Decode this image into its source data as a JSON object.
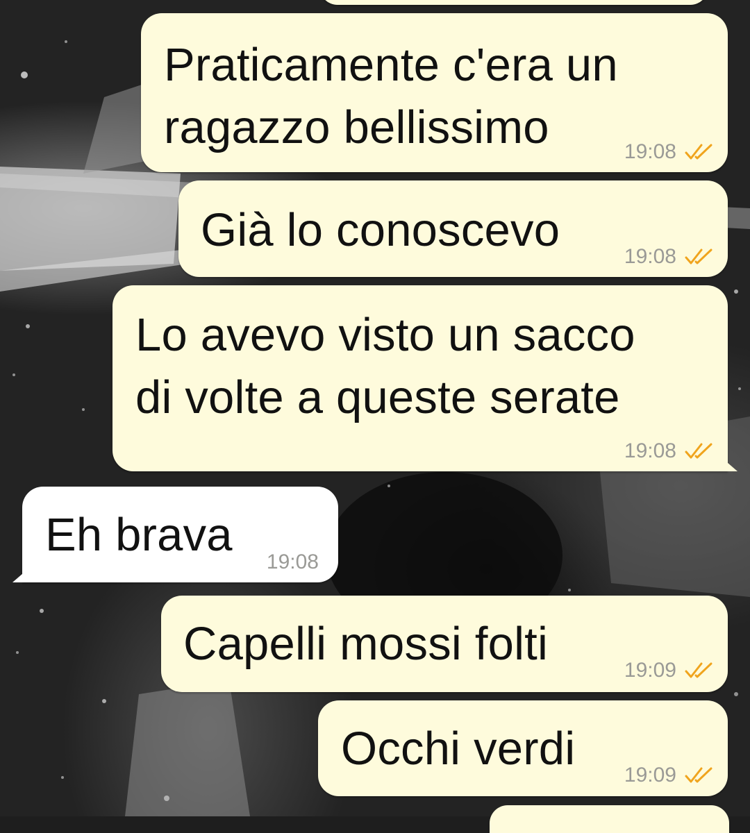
{
  "status_color": "#f0a41d",
  "messages": [
    {
      "direction": "outgoing",
      "text": "Praticamente c'era un\nragazzo bellissimo",
      "time": "19:08",
      "status_icon": "double-check-icon"
    },
    {
      "direction": "outgoing",
      "text": "Già lo conoscevo",
      "time": "19:08",
      "status_icon": "double-check-icon"
    },
    {
      "direction": "outgoing",
      "text": "Lo avevo visto un sacco\ndi volte a queste serate",
      "time": "19:08",
      "status_icon": "double-check-icon"
    },
    {
      "direction": "incoming",
      "text": "Eh brava",
      "time": "19:08"
    },
    {
      "direction": "outgoing",
      "text": "Capelli mossi folti",
      "time": "19:09",
      "status_icon": "double-check-icon"
    },
    {
      "direction": "outgoing",
      "text": "Occhi verdi",
      "time": "19:09",
      "status_icon": "double-check-icon"
    }
  ]
}
